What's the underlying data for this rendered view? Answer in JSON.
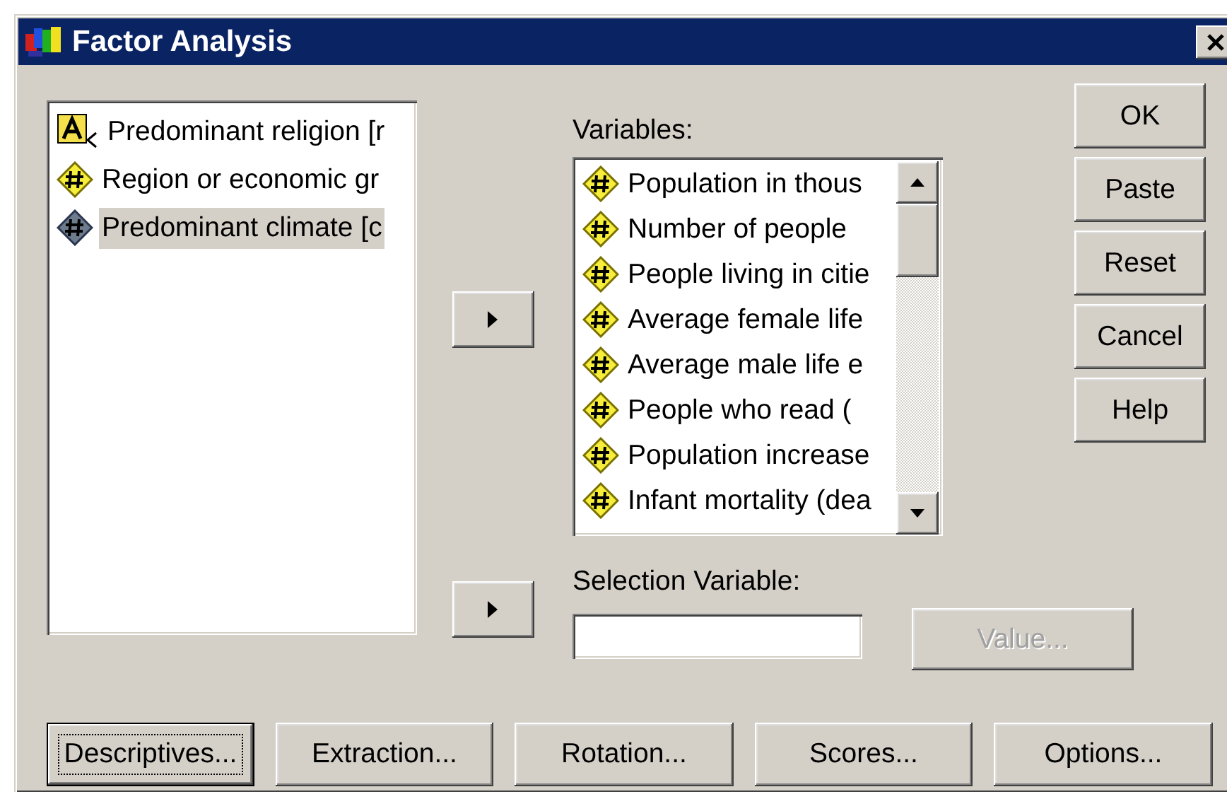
{
  "window": {
    "title": "Factor Analysis"
  },
  "source_list": {
    "items": [
      {
        "label": "Predominant religion [r",
        "kind": "string",
        "selected": false
      },
      {
        "label": "Region or economic gr",
        "kind": "numeric",
        "selected": false
      },
      {
        "label": "Predominant climate [c",
        "kind": "numeric",
        "selected": true
      }
    ]
  },
  "variables": {
    "label": "Variables:",
    "items": [
      {
        "label": "Population in thous",
        "kind": "numeric",
        "selected": false
      },
      {
        "label": "Number of people",
        "kind": "numeric",
        "selected": false
      },
      {
        "label": "People living in citie",
        "kind": "numeric",
        "selected": false
      },
      {
        "label": "Average female life",
        "kind": "numeric",
        "selected": false
      },
      {
        "label": "Average male life e",
        "kind": "numeric",
        "selected": false
      },
      {
        "label": "People who read (",
        "kind": "numeric",
        "selected": false
      },
      {
        "label": "Population increase",
        "kind": "numeric",
        "selected": false
      },
      {
        "label": "Infant mortality (dea",
        "kind": "numeric",
        "selected": false
      }
    ]
  },
  "selection": {
    "label": "Selection Variable:",
    "value_button": {
      "label": "Value...",
      "disabled": true
    }
  },
  "side_buttons": [
    {
      "label": "OK"
    },
    {
      "label": "Paste"
    },
    {
      "label": "Reset"
    },
    {
      "label": "Cancel"
    },
    {
      "label": "Help"
    }
  ],
  "bottom_buttons": [
    {
      "label": "Descriptives...",
      "focused": true
    },
    {
      "label": "Extraction...",
      "focused": false
    },
    {
      "label": "Rotation...",
      "focused": false
    },
    {
      "label": "Scores...",
      "focused": false
    },
    {
      "label": "Options...",
      "focused": false
    }
  ]
}
